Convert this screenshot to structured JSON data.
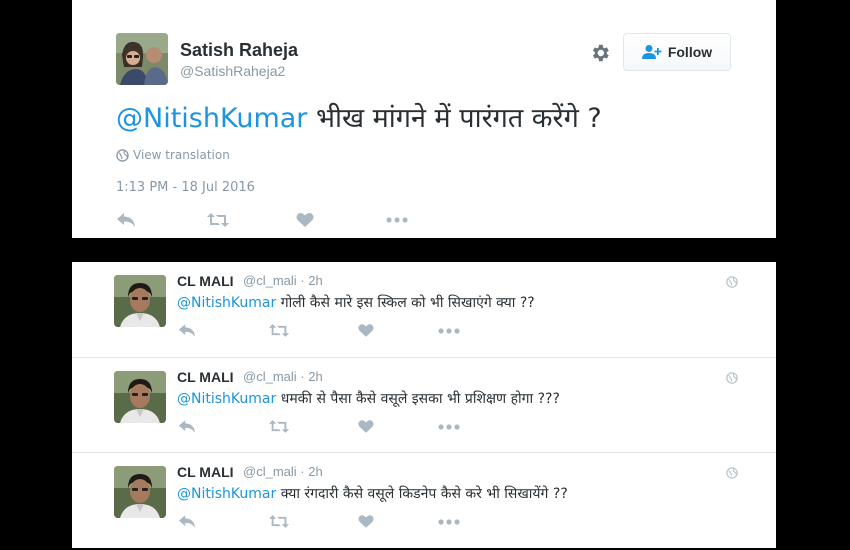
{
  "tweet": {
    "author_name": "Satish Raheja",
    "author_handle": "@SatishRaheja2",
    "follow_label": "Follow",
    "mention": "@NitishKumar",
    "body": "भीख मांगने में पारंगत करेंगे ?",
    "view_translation": "View translation",
    "timestamp": "1:13 PM - 18 Jul 2016"
  },
  "replies": [
    {
      "name": "CL MALI",
      "handle": "@cl_mali",
      "age": "2h",
      "mention": "@NitishKumar",
      "text": "गोली कैसे मारे इस स्किल को भी सिखाएंगे क्या ??"
    },
    {
      "name": "CL MALI",
      "handle": "@cl_mali",
      "age": "2h",
      "mention": "@NitishKumar",
      "text": "धमकी से पैसा कैसे वसूले इसका भी प्रशिक्षण होगा ???"
    },
    {
      "name": "CL MALI",
      "handle": "@cl_mali",
      "age": "2h",
      "mention": "@NitishKumar",
      "text": "क्या रंगदारी कैसे वसूले किडनेप कैसे करे भी सिखायेंगे ??"
    }
  ],
  "colors": {
    "link": "#1b95e0",
    "secondary_text": "#8899a6",
    "icon": "#aab8c2"
  },
  "icons": [
    "gear-icon",
    "follow-user-icon",
    "globe-icon",
    "reply-icon",
    "retweet-icon",
    "like-icon",
    "more-icon"
  ]
}
